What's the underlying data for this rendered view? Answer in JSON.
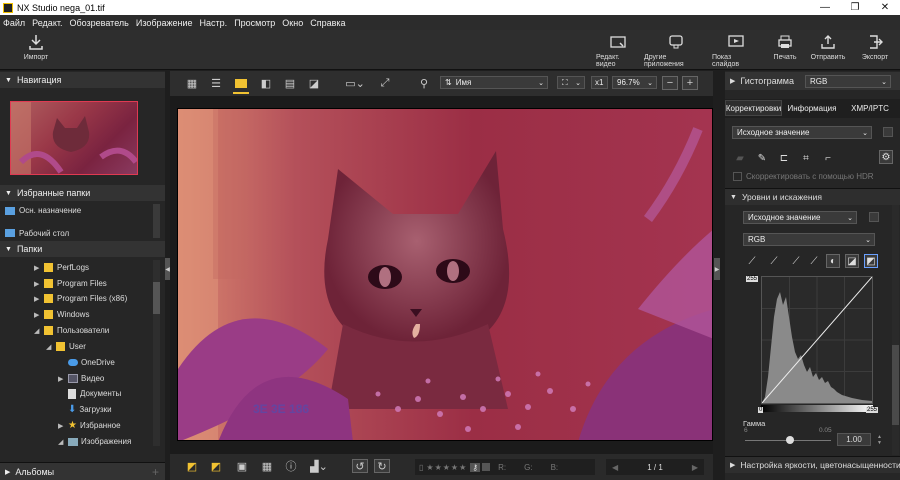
{
  "window": {
    "title": "nega_01.tif",
    "app_name": "NX Studio"
  },
  "menu": [
    "Файл",
    "Редакт.",
    "Обозреватель",
    "Изображение",
    "Настр.",
    "Просмотр",
    "Окно",
    "Справка"
  ],
  "toolbar": {
    "import_label": "Импорт",
    "edit_video_label": "Редакт. видео",
    "other_apps_label": "Другие приложения",
    "slideshow_label": "Показ слайдов",
    "print_label": "Печать",
    "send_label": "Отправить",
    "export_label": "Экспорт"
  },
  "left_panel": {
    "navigation_title": "Навигация",
    "favorites_title": "Избранные папки",
    "favorites": [
      "Осн. назначение",
      "Рабочий стол"
    ],
    "folders_title": "Папки",
    "tree": [
      {
        "label": "PerfLogs",
        "type": "folder",
        "arrow": "▶"
      },
      {
        "label": "Program Files",
        "type": "folder",
        "arrow": "▶"
      },
      {
        "label": "Program Files (x86)",
        "type": "folder",
        "arrow": "▶"
      },
      {
        "label": "Windows",
        "type": "folder",
        "arrow": "▶"
      },
      {
        "label": "Пользователи",
        "type": "folder",
        "arrow": "◢"
      },
      {
        "label": "User",
        "type": "folder",
        "arrow": "◢"
      },
      {
        "label": "OneDrive",
        "type": "cloud",
        "arrow": ""
      },
      {
        "label": "Видео",
        "type": "video",
        "arrow": "▶"
      },
      {
        "label": "Документы",
        "type": "doc",
        "arrow": ""
      },
      {
        "label": "Загрузки",
        "type": "download",
        "arrow": ""
      },
      {
        "label": "Избранное",
        "type": "star",
        "arrow": "▶"
      },
      {
        "label": "Изображения",
        "type": "image",
        "arrow": "◢"
      }
    ],
    "albums_title": "Альбомы"
  },
  "center": {
    "sort_label": "Имя",
    "zoom_x1": "x1",
    "zoom_level": "96.7%",
    "page": "1 / 1",
    "channels": [
      "R:",
      "G:",
      "B:"
    ],
    "photo_caption": "3E 3E 186"
  },
  "right_panel": {
    "histogram_title": "Гистограмма",
    "histogram_channel": "RGB",
    "tabs": [
      "Корректировки",
      "Информация",
      "XMP/IPTC"
    ],
    "preset": "Исходное значение",
    "hdr_label": "Скорректировать с помощью HDR",
    "levels_title": "Уровни и искажения",
    "levels_preset": "Исходное значение",
    "levels_channel": "RGB",
    "curve_top": "255",
    "curve_bottom_left": "0",
    "curve_bottom_right": "255",
    "gamma_label": "Гамма",
    "gamma_min": "6",
    "gamma_mid": "0.05",
    "gamma_value": "1.00",
    "bottom_section": "Настройка яркости, цветонасыщенности"
  },
  "colors": {
    "accent": "#f1c232",
    "photo_tint": "#a3304a"
  }
}
